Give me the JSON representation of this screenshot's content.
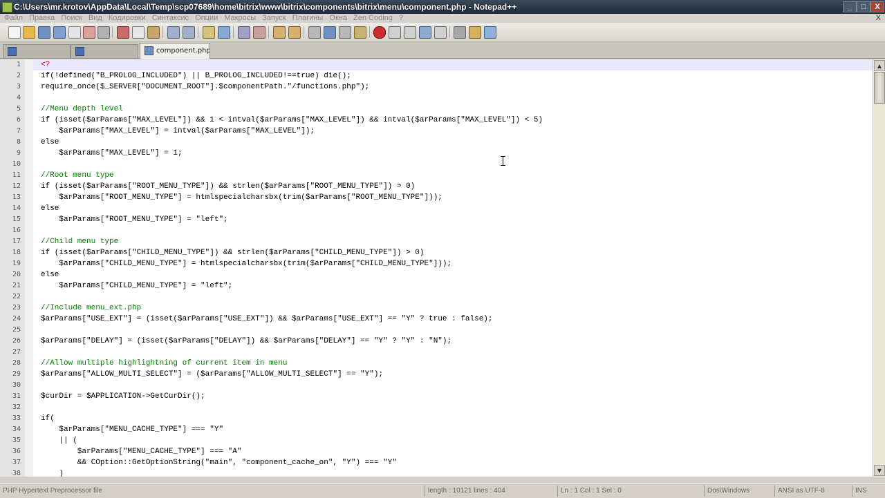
{
  "window": {
    "title": "C:\\Users\\mr.krotov\\AppData\\Local\\Temp\\scp07689\\home\\bitrix\\www\\bitrix\\components\\bitrix\\menu\\component.php - Notepad++",
    "minimize": "_",
    "maximize": "□",
    "close": "X"
  },
  "menu": {
    "items": [
      "Файл",
      "Правка",
      "Поиск",
      "Вид",
      "Кодировки",
      "Синтаксис",
      "Опции",
      "Макросы",
      "Запуск",
      "Плагины",
      "Окна",
      "Zen Coding",
      "?"
    ],
    "close": "X"
  },
  "tabs": [
    {
      "label": "",
      "active": false
    },
    {
      "label": "",
      "active": false
    },
    {
      "label": "component.php",
      "active": true
    }
  ],
  "editor": {
    "current_line": 1,
    "lines": [
      {
        "n": "1",
        "text": "<?"
      },
      {
        "n": "2",
        "text": "if(!defined(\"B_PROLOG_INCLUDED\") || B_PROLOG_INCLUDED!==true) die();"
      },
      {
        "n": "3",
        "text": "require_once($_SERVER[\"DOCUMENT_ROOT\"].$componentPath.\"/functions.php\");"
      },
      {
        "n": "4",
        "text": ""
      },
      {
        "n": "5",
        "text": "//Menu depth level"
      },
      {
        "n": "6",
        "text": "if (isset($arParams[\"MAX_LEVEL\"]) && 1 < intval($arParams[\"MAX_LEVEL\"]) && intval($arParams[\"MAX_LEVEL\"]) < 5)"
      },
      {
        "n": "7",
        "text": "    $arParams[\"MAX_LEVEL\"] = intval($arParams[\"MAX_LEVEL\"]);"
      },
      {
        "n": "8",
        "text": "else"
      },
      {
        "n": "9",
        "text": "    $arParams[\"MAX_LEVEL\"] = 1;"
      },
      {
        "n": "10",
        "text": ""
      },
      {
        "n": "11",
        "text": "//Root menu type"
      },
      {
        "n": "12",
        "text": "if (isset($arParams[\"ROOT_MENU_TYPE\"]) && strlen($arParams[\"ROOT_MENU_TYPE\"]) > 0)"
      },
      {
        "n": "13",
        "text": "    $arParams[\"ROOT_MENU_TYPE\"] = htmlspecialcharsbx(trim($arParams[\"ROOT_MENU_TYPE\"]));"
      },
      {
        "n": "14",
        "text": "else"
      },
      {
        "n": "15",
        "text": "    $arParams[\"ROOT_MENU_TYPE\"] = \"left\";"
      },
      {
        "n": "16",
        "text": ""
      },
      {
        "n": "17",
        "text": "//Child menu type"
      },
      {
        "n": "18",
        "text": "if (isset($arParams[\"CHILD_MENU_TYPE\"]) && strlen($arParams[\"CHILD_MENU_TYPE\"]) > 0)"
      },
      {
        "n": "19",
        "text": "    $arParams[\"CHILD_MENU_TYPE\"] = htmlspecialcharsbx(trim($arParams[\"CHILD_MENU_TYPE\"]));"
      },
      {
        "n": "20",
        "text": "else"
      },
      {
        "n": "21",
        "text": "    $arParams[\"CHILD_MENU_TYPE\"] = \"left\";"
      },
      {
        "n": "22",
        "text": ""
      },
      {
        "n": "23",
        "text": "//Include menu_ext.php"
      },
      {
        "n": "24",
        "text": "$arParams[\"USE_EXT\"] = (isset($arParams[\"USE_EXT\"]) && $arParams[\"USE_EXT\"] == \"Y\" ? true : false);"
      },
      {
        "n": "25",
        "text": ""
      },
      {
        "n": "26",
        "text": "$arParams[\"DELAY\"] = (isset($arParams[\"DELAY\"]) && $arParams[\"DELAY\"] == \"Y\" ? \"Y\" : \"N\");"
      },
      {
        "n": "27",
        "text": ""
      },
      {
        "n": "28",
        "text": "//Allow multiple highlightning of current item in menu"
      },
      {
        "n": "29",
        "text": "$arParams[\"ALLOW_MULTI_SELECT\"] = ($arParams[\"ALLOW_MULTI_SELECT\"] == \"Y\");"
      },
      {
        "n": "30",
        "text": ""
      },
      {
        "n": "31",
        "text": "$curDir = $APPLICATION->GetCurDir();"
      },
      {
        "n": "32",
        "text": ""
      },
      {
        "n": "33",
        "text": "if("
      },
      {
        "n": "34",
        "text": "    $arParams[\"MENU_CACHE_TYPE\"] === \"Y\""
      },
      {
        "n": "35",
        "text": "    || ("
      },
      {
        "n": "36",
        "text": "        $arParams[\"MENU_CACHE_TYPE\"] === \"A\""
      },
      {
        "n": "37",
        "text": "        && COption::GetOptionString(\"main\", \"component_cache_on\", \"Y\") === \"Y\""
      },
      {
        "n": "38",
        "text": "    )"
      }
    ]
  },
  "status": {
    "file_type": "PHP Hypertext Preprocessor file",
    "length": "length : 10121   lines : 404",
    "position": "Ln : 1   Col : 1   Sel : 0",
    "eol": "Dos\\Windows",
    "encoding": "ANSI as UTF-8",
    "mode": "INS"
  },
  "colors": {
    "keyword": "#00008b",
    "comment": "#008000",
    "string": "#555555",
    "current_line": "#e8e8ff"
  }
}
